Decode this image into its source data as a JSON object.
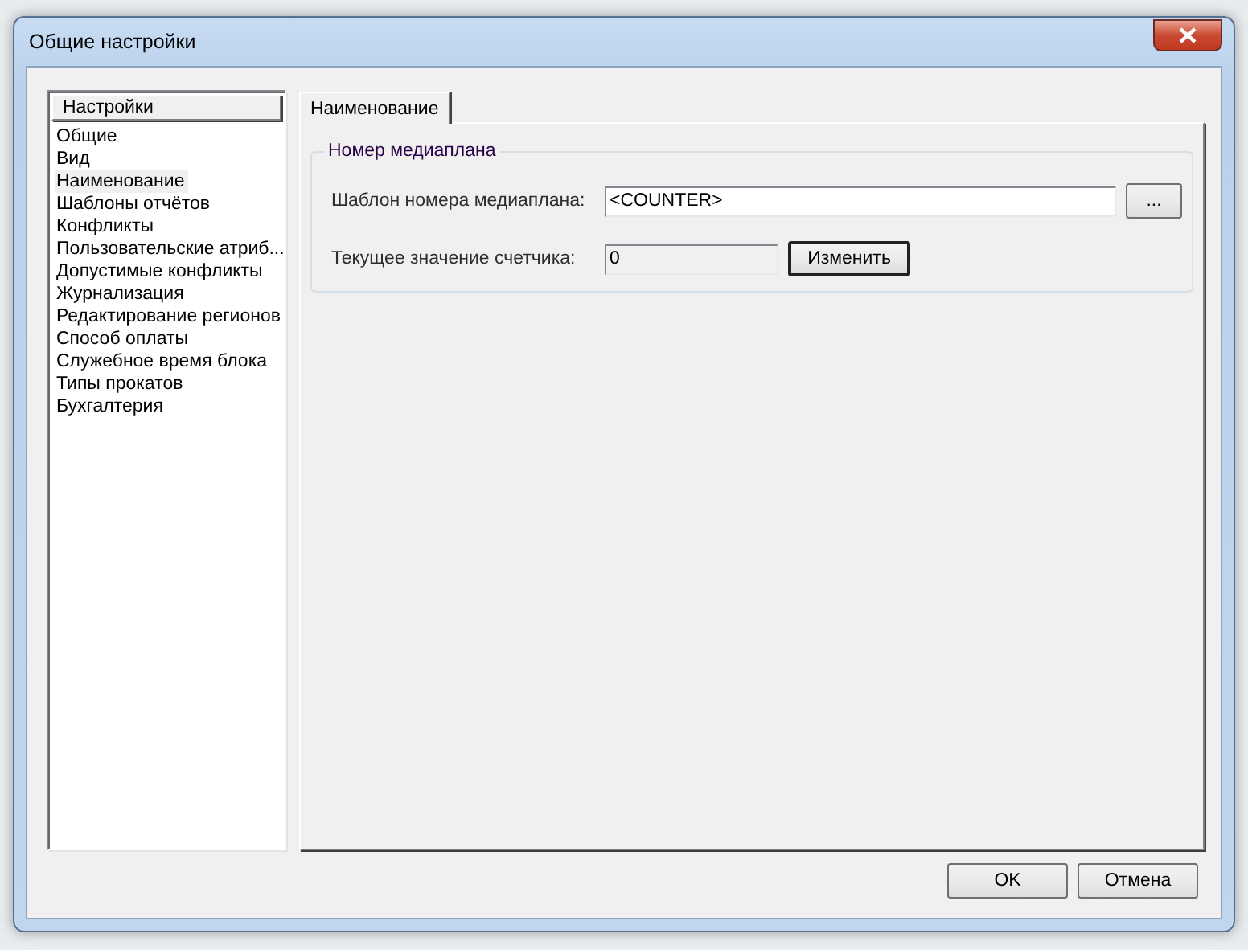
{
  "window": {
    "title": "Общие настройки"
  },
  "sidebar": {
    "header": "Настройки",
    "items": [
      {
        "label": "Общие",
        "selected": false
      },
      {
        "label": "Вид",
        "selected": false
      },
      {
        "label": "Наименование",
        "selected": true
      },
      {
        "label": "Шаблоны отчётов",
        "selected": false
      },
      {
        "label": "Конфликты",
        "selected": false
      },
      {
        "label": "Пользовательские атриб...",
        "selected": false
      },
      {
        "label": "Допустимые конфликты",
        "selected": false
      },
      {
        "label": "Журнализация",
        "selected": false
      },
      {
        "label": "Редактирование регионов",
        "selected": false
      },
      {
        "label": "Способ оплаты",
        "selected": false
      },
      {
        "label": "Служебное время блока",
        "selected": false
      },
      {
        "label": "Типы прокатов",
        "selected": false
      },
      {
        "label": "Бухгалтерия",
        "selected": false
      }
    ]
  },
  "tabs": [
    {
      "label": "Наименование",
      "selected": true
    }
  ],
  "group": {
    "title": "Номер медиаплана",
    "template_label": "Шаблон номера медиаплана:",
    "template_value": "<COUNTER>",
    "browse_button": "...",
    "counter_label": "Текущее значение счетчика:",
    "counter_value": "0",
    "counter_disabled": true,
    "change_button": "Изменить"
  },
  "buttons": [
    "OK",
    "Отмена"
  ]
}
